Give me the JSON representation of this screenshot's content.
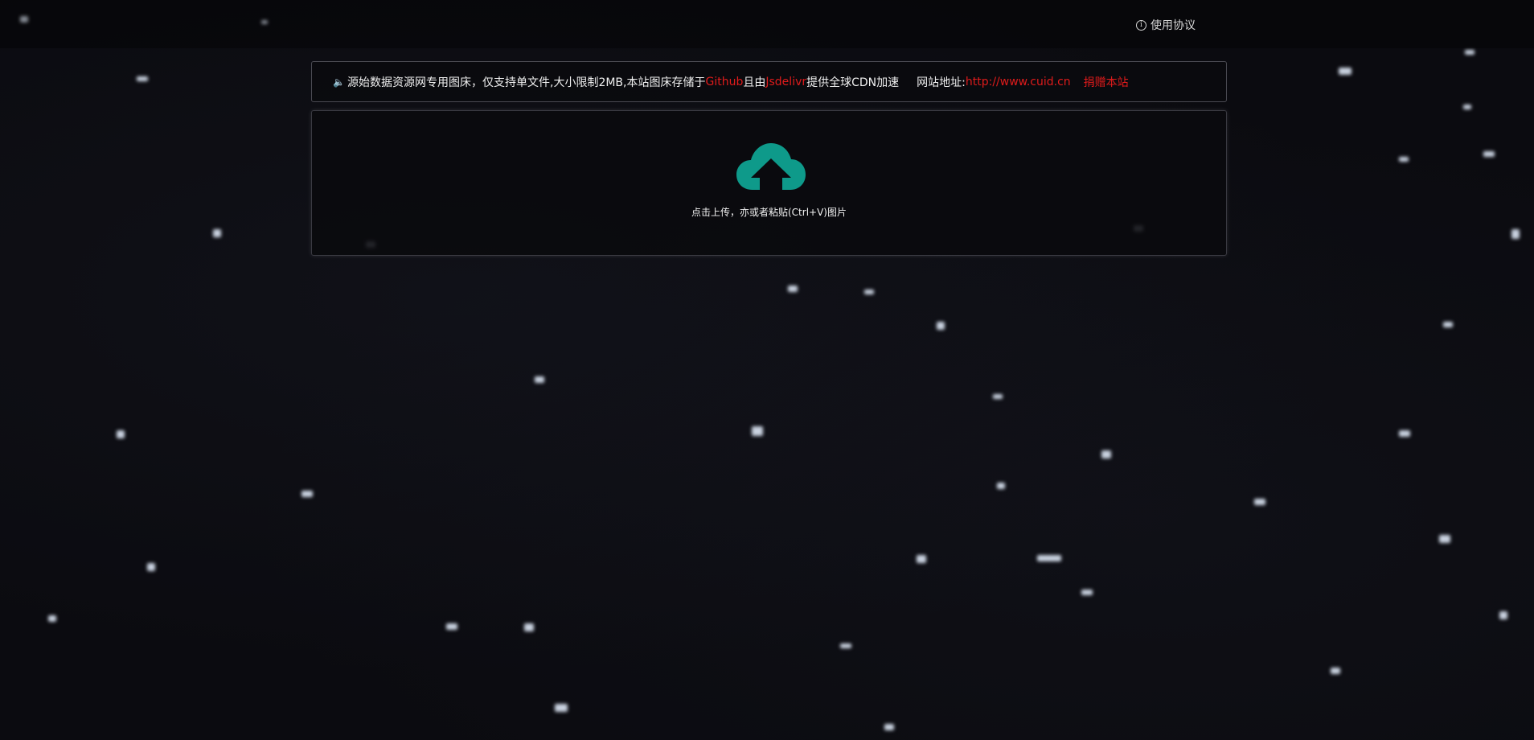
{
  "header": {
    "agreement_label": "使用协议",
    "agreement_icon": "info-icon"
  },
  "notice": {
    "icon": "speaker-icon",
    "text_1": "源始数据资源网专用图床，仅支持单文件,大小限制2MB,本站图床存储于",
    "github": "Github",
    "text_2": "且由",
    "jsdelivr": "Jsdelivr",
    "text_3": "提供全球CDN加速",
    "site_label": "网站地址:",
    "site_url": "http://www.cuid.cn",
    "donate_label": "捐赠本站",
    "highlight_color": "#e01b1b"
  },
  "upload": {
    "icon": "cloud-upload-icon",
    "icon_color": "#0e9a8a",
    "hint": "点击上传，亦或者粘贴(Ctrl+V)图片"
  }
}
